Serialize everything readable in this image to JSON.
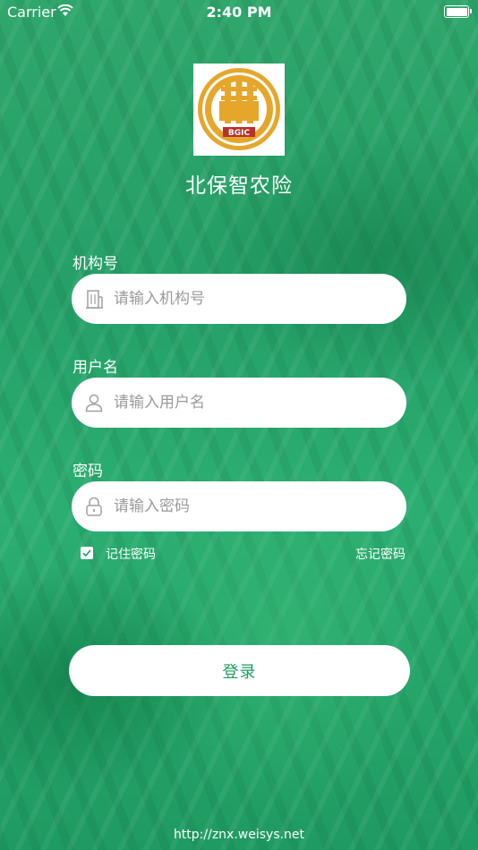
{
  "status_bar": {
    "carrier": "Carrier",
    "time": "2:40 PM"
  },
  "logo": {
    "text": "BGIC",
    "icon": "bgic-logo"
  },
  "app_title": "北保智农险",
  "form": {
    "org_label": "机构号",
    "org_placeholder": "请输入机构号",
    "user_label": "用户名",
    "user_placeholder": "请输入用户名",
    "password_label": "密码",
    "password_placeholder": "请输入密码",
    "remember_label": "记住密码",
    "remember_checked": true,
    "forgot_label": "忘记密码",
    "login_label": "登录"
  },
  "footer_url": "http://znx.weisys.net",
  "colors": {
    "brand_green": "#1f9a62",
    "logo_gold": "#e0a52a",
    "logo_red": "#b5322a"
  }
}
